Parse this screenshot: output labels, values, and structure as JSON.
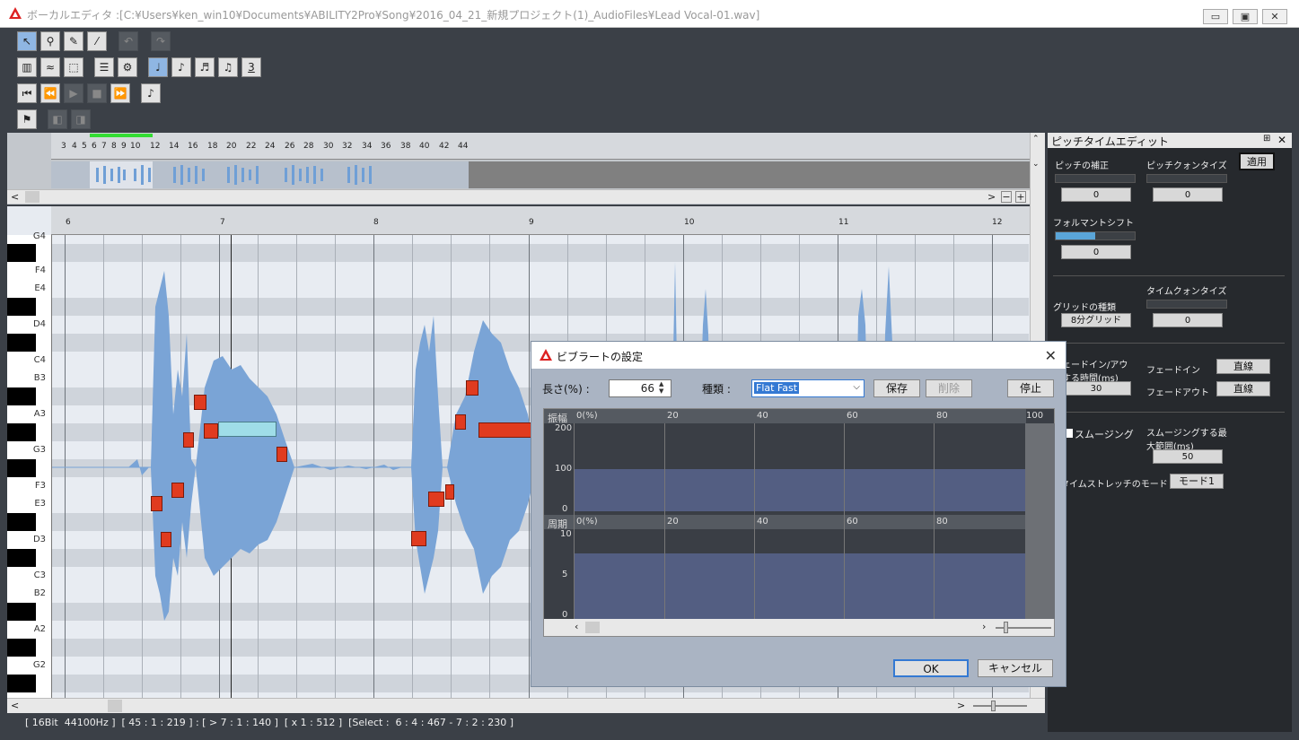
{
  "window": {
    "title": "ボーカルエディタ :[C:¥Users¥ken_win10¥Documents¥ABILITY2Pro¥Song¥2016_04_21_新規プロジェクト(1)_AudioFiles¥Lead Vocal-01.wav]",
    "minimize": "▭",
    "maximize": "▣",
    "close": "✕"
  },
  "toolbar": {
    "undo": "↶",
    "redo": "↷",
    "quant3": "3"
  },
  "overview": {
    "ruler": [
      "3",
      "4",
      "5",
      "6",
      "7",
      "8",
      "9",
      "10",
      "12",
      "14",
      "16",
      "18",
      "20",
      "22",
      "24",
      "26",
      "28",
      "30",
      "32",
      "34",
      "36",
      "38",
      "40",
      "42",
      "44"
    ],
    "zoom_minus": "−",
    "zoom_plus": "+",
    "scroll_left": "<",
    "scroll_right": ">"
  },
  "editor": {
    "bars": [
      "6",
      "7",
      "8",
      "9",
      "10",
      "11",
      "12"
    ],
    "keys": [
      "G4",
      "F4",
      "E4",
      "D4",
      "C4",
      "B3",
      "A3",
      "G3",
      "F3",
      "E3",
      "D3",
      "C3",
      "B2",
      "A2",
      "G2"
    ],
    "scroll_left": "<",
    "scroll_right": ">"
  },
  "status": "[ 16Bit  44100Hz ]  [ 45 : 1 : 219 ] : [ > 7 : 1 : 140 ]  [ x 1 : 512 ]  [Select :  6 : 4 : 467 - 7 : 2 : 230 ]",
  "panel": {
    "title": "ピッチタイムエディット",
    "pin": "⊞",
    "close": "✕",
    "pitch_correct": "ピッチの補正",
    "pitch_quant": "ピッチクォンタイズ",
    "apply": "適用",
    "pc_val": "0",
    "pq_val": "0",
    "formant": "フォルマントシフト",
    "formant_val": "0",
    "time_quant": "タイムクォンタイズ",
    "grid_type": "グリッドの種類",
    "grid_val": "8分グリッド",
    "tq_val": "0",
    "fade_time": "フェードイン/アウトする時間(ms)",
    "fade_val": "30",
    "fade_in": "フェードイン",
    "fade_in_val": "直線",
    "fade_out": "フェードアウト",
    "fade_out_val": "直線",
    "smoothing": "スムージング",
    "smooth_max": "スムージングする最大範囲(ms)",
    "smooth_val": "50",
    "stretch_mode": "タイムストレッチのモード",
    "stretch_val": "モード1"
  },
  "dialog": {
    "title": "ビブラートの設定",
    "length_label": "長さ(%) :",
    "length_val": "66",
    "type_label": "種類 :",
    "type_val": "Flat Fast",
    "save": "保存",
    "delete": "削除",
    "stop": "停止",
    "amp_label": "振幅",
    "period_label": "周期",
    "amp_scale": [
      "200",
      "100",
      "0"
    ],
    "period_scale": [
      "10",
      "5",
      "0"
    ],
    "x_ticks": [
      "0(%)",
      "20",
      "40",
      "60",
      "80",
      "100"
    ],
    "ok": "OK",
    "cancel": "キャンセル"
  }
}
